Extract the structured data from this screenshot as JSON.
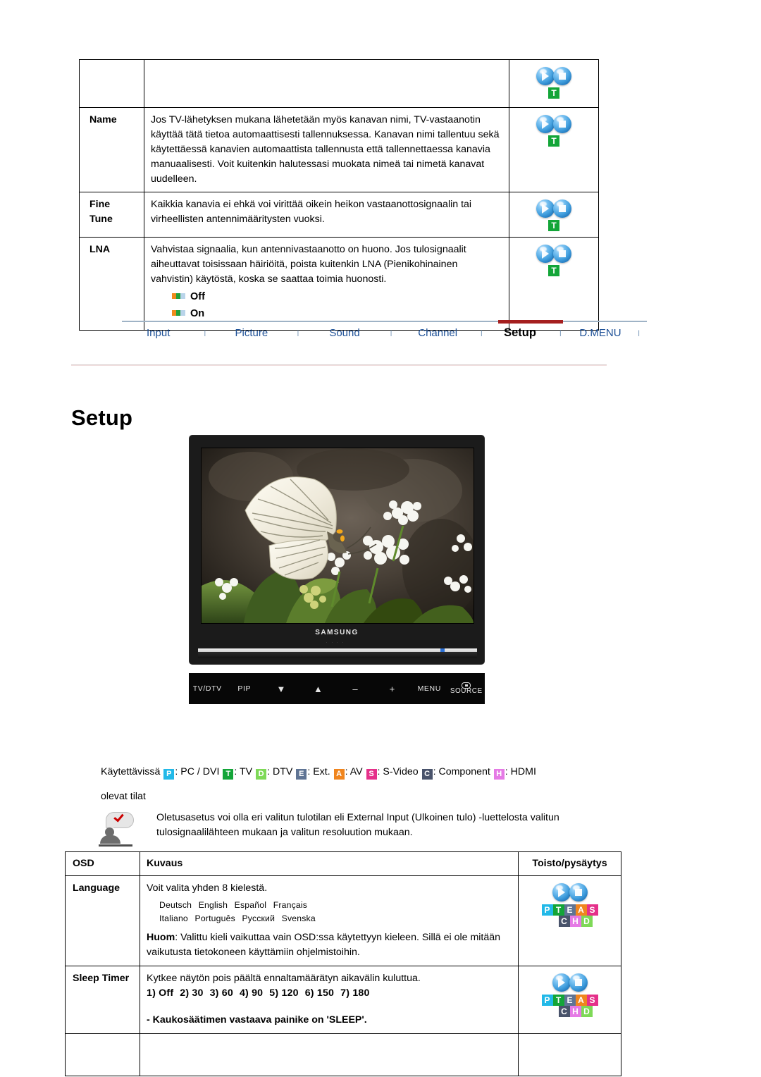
{
  "top_table": {
    "rows": [
      {
        "label": "",
        "label2": "",
        "desc": "",
        "icon": {
          "spheres": [
            "play",
            "stop"
          ],
          "badges": [
            [
              "T"
            ]
          ]
        }
      },
      {
        "label": "Name",
        "label2": "",
        "desc": "Jos TV-lähetyksen mukana lähetetään myös kanavan nimi, TV-vastaanotin käyttää tätä tietoa automaattisesti tallennuksessa. Kanavan nimi tallentuu sekä käytettäessä kanavien automaattista tallennusta että tallennettaessa kanavia manuaalisesti. Voit kuitenkin halutessasi muokata nimeä tai nimetä kanavat uudelleen.",
        "icon": {
          "spheres": [
            "play",
            "stop"
          ],
          "badges": [
            [
              "T"
            ]
          ]
        }
      },
      {
        "label": "Fine",
        "label2": "Tune",
        "desc": "Kaikkia kanavia ei ehkä voi virittää oikein heikon vastaanottosignaalin tai virheellisten antennimääritysten vuoksi.",
        "icon": {
          "spheres": [
            "play",
            "stop"
          ],
          "badges": [
            [
              "T"
            ]
          ]
        }
      },
      {
        "label": "LNA",
        "label2": "",
        "desc": "Vahvistaa signaalia, kun antennivastaanotto on huono. Jos tulosignaalit aiheuttavat toisissaan häiriöitä, poista kuitenkin LNA (Pienikohinainen vahvistin) käytöstä, koska se saattaa toimia huonosti.",
        "options": [
          "Off",
          "On"
        ],
        "icon": {
          "spheres": [
            "play",
            "stop"
          ],
          "badges": [
            [
              "T"
            ]
          ]
        }
      }
    ]
  },
  "nav": {
    "items": [
      {
        "label": "Input",
        "active": false
      },
      {
        "label": "Picture",
        "active": false
      },
      {
        "label": "Sound",
        "active": false
      },
      {
        "label": "Channel",
        "active": false
      },
      {
        "label": "Setup",
        "active": true
      },
      {
        "label": "D.MENU",
        "active": false
      }
    ],
    "separator": "I",
    "active_color": "#a51f1f",
    "link_color": "#1c4f96"
  },
  "page_title": "Setup",
  "monitor": {
    "brand": "SAMSUNG",
    "control_panel": [
      {
        "label": "TV/DTV",
        "type": "text"
      },
      {
        "label": "PIP",
        "type": "text"
      },
      {
        "label": "▼",
        "type": "glyph"
      },
      {
        "label": "▲",
        "type": "glyph"
      },
      {
        "label": "–",
        "type": "glyph"
      },
      {
        "label": "+",
        "type": "glyph"
      },
      {
        "label": "MENU",
        "type": "text"
      },
      {
        "label": "SOURCE",
        "type": "source"
      }
    ]
  },
  "legend": {
    "prefix": "Käytettävissä",
    "entries": [
      {
        "key": "P",
        "text": ": PC / DVI",
        "color": "#22b9e8"
      },
      {
        "key": "T",
        "text": ": TV",
        "color": "#13a538"
      },
      {
        "key": "D",
        "text": ": DTV",
        "color": "#7ed957"
      },
      {
        "key": "E",
        "text": ": Ext.",
        "color": "#5f7494"
      },
      {
        "key": "A",
        "text": ": AV",
        "color": "#f0851e"
      },
      {
        "key": "S",
        "text": ": S-Video",
        "color": "#e5308a"
      },
      {
        "key": "C",
        "text": ": Component",
        "color": "#49536b"
      },
      {
        "key": "H",
        "text": ": HDMI",
        "color": "#e57ae5"
      }
    ],
    "line2": "olevat tilat"
  },
  "note": {
    "text": "Oletusasetus voi olla eri valitun tulotilan eli External Input (Ulkoinen tulo) -luettelosta valitun tulosignaalilähteen mukaan ja valitun resoluution mukaan."
  },
  "bottom_table": {
    "headers": {
      "col1": "OSD",
      "col2": "Kuvaus",
      "col3": "Toisto/pysäytys"
    },
    "rows": [
      {
        "label": "Language",
        "desc": "Voit valita yhden 8 kielestä.",
        "languages_line1": [
          "Deutsch",
          "English",
          "Español",
          "Français"
        ],
        "languages_line2": [
          "Italiano",
          "Português",
          "Русский",
          "Svenska"
        ],
        "note_label": "Huom",
        "note_text": ": Valittu kieli vaikuttaa vain OSD:ssa käytettyyn kieleen. Sillä ei ole mitään vaikutusta tietokoneen käyttämiin ohjelmistoihin.",
        "icon": {
          "spheres": [
            "play",
            "stop"
          ],
          "badges": [
            [
              "P",
              "T",
              "E",
              "A",
              "S"
            ],
            [
              "C",
              "H",
              "D"
            ]
          ]
        }
      },
      {
        "label": "Sleep Timer",
        "desc": "Kytkee näytön pois päältä ennaltamäärätyn aikavälin kuluttua.",
        "sleep_options": [
          "1) Off",
          "2) 30",
          "3) 60",
          "4) 90",
          "5) 120",
          "6) 150",
          "7) 180"
        ],
        "sleep_note": "- Kaukosäätimen vastaava painike on 'SLEEP'.",
        "icon": {
          "spheres": [
            "play",
            "stop"
          ],
          "badges": [
            [
              "P",
              "T",
              "E",
              "A",
              "S"
            ],
            [
              "C",
              "H",
              "D"
            ]
          ]
        }
      },
      {
        "label": "",
        "desc": "",
        "icon": null
      }
    ]
  },
  "badge_colors": {
    "P": "#22b9e8",
    "T": "#13a538",
    "E": "#5f7494",
    "A": "#f0851e",
    "S": "#e5308a",
    "C": "#49536b",
    "H": "#e57ae5",
    "D": "#7ed957"
  }
}
